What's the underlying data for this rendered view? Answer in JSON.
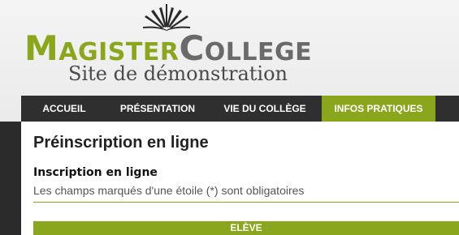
{
  "header": {
    "logo_part1_cap": "M",
    "logo_part1_rest": "AGISTER",
    "logo_part2_cap": "C",
    "logo_part2_rest": "OLLEGE",
    "tagline": "Site de démonstration",
    "icon": "open-book-icon"
  },
  "nav": {
    "items": [
      {
        "label": "ACCUEIL"
      },
      {
        "label": "PRÉSENTATION"
      },
      {
        "label": "VIE DU COLLÈGE"
      },
      {
        "label": "INFOS PRATIQUES"
      }
    ],
    "active_index": 3
  },
  "main": {
    "title": "Préinscription en ligne",
    "section_title": "Inscription en ligne",
    "required_note": "Les champs marqués d'une étoile (*) sont obligatoires",
    "bar_label": "ELÈVE"
  },
  "colors": {
    "accent": "#8aa61c",
    "nav_bg": "#2f2f2f",
    "logo_grey": "#6a6a6a"
  }
}
